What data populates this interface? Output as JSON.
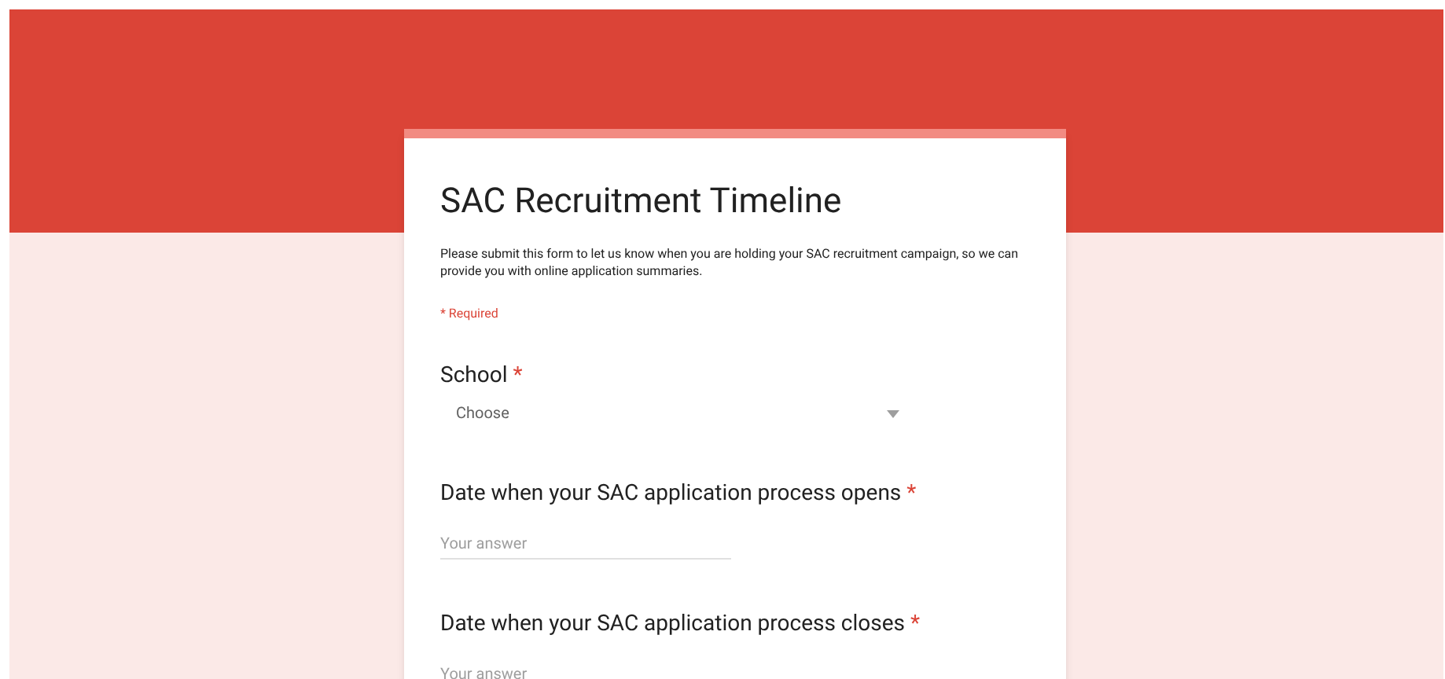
{
  "form": {
    "title": "SAC Recruitment Timeline",
    "description": "Please submit this form to let us know when you are holding your SAC recruitment campaign, so we can provide you with online application summaries.",
    "required_note": "* Required",
    "questions": [
      {
        "kind": "dropdown",
        "label": "School",
        "required_mark": "*",
        "placeholder": "Choose"
      },
      {
        "kind": "text",
        "label": "Date when your SAC application process opens",
        "required_mark": "*",
        "placeholder": "Your answer"
      },
      {
        "kind": "text",
        "label": "Date when your SAC application process closes",
        "required_mark": "*",
        "placeholder": "Your answer"
      }
    ]
  }
}
